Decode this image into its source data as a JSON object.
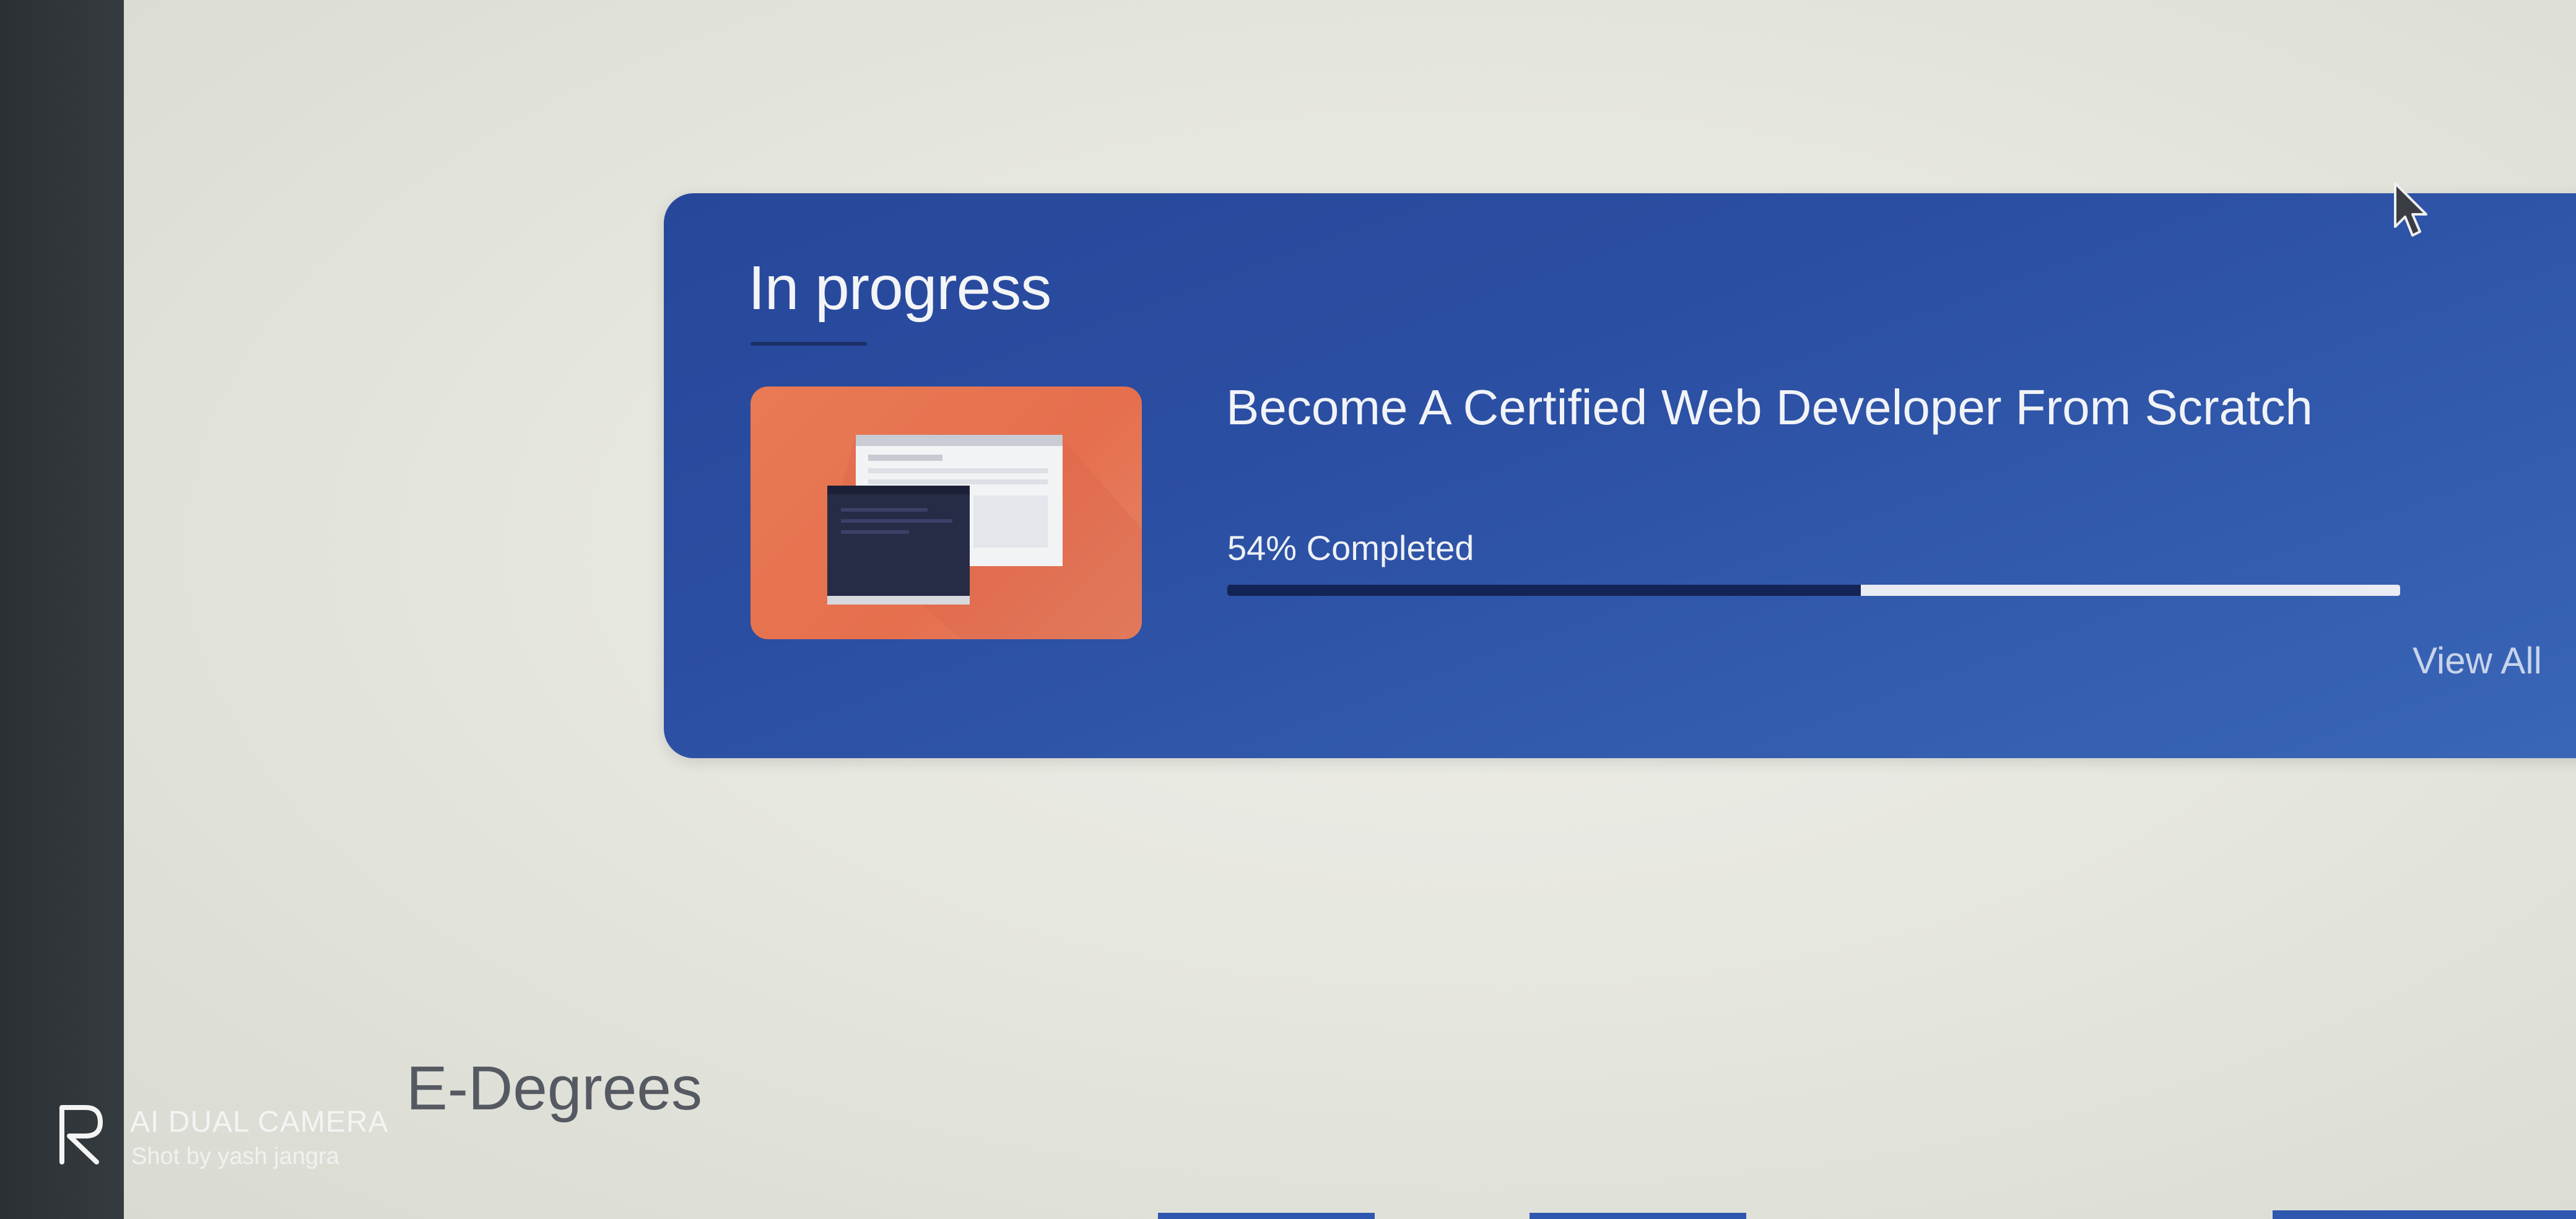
{
  "card": {
    "title": "In progress",
    "course": {
      "title": "Become A Certified Web Developer From Scratch",
      "progress_label": "54% Completed",
      "progress_fraction": 0.54
    },
    "view_all_label": "View All"
  },
  "sections": {
    "e_degrees_heading": "E-Degrees"
  },
  "watermark": {
    "line1": "AI DUAL CAMERA",
    "line2": "Shot by yash jangra"
  },
  "colors": {
    "card_blue": "#2b4fa3",
    "thumbnail_orange": "#e56f4e",
    "progress_fill": "#142456",
    "progress_track": "#e9ecf2"
  },
  "icons": {
    "thumbnail": "browser-window-illustration",
    "cursor": "mouse-pointer-icon",
    "watermark_logo": "camera-brand-logo"
  }
}
